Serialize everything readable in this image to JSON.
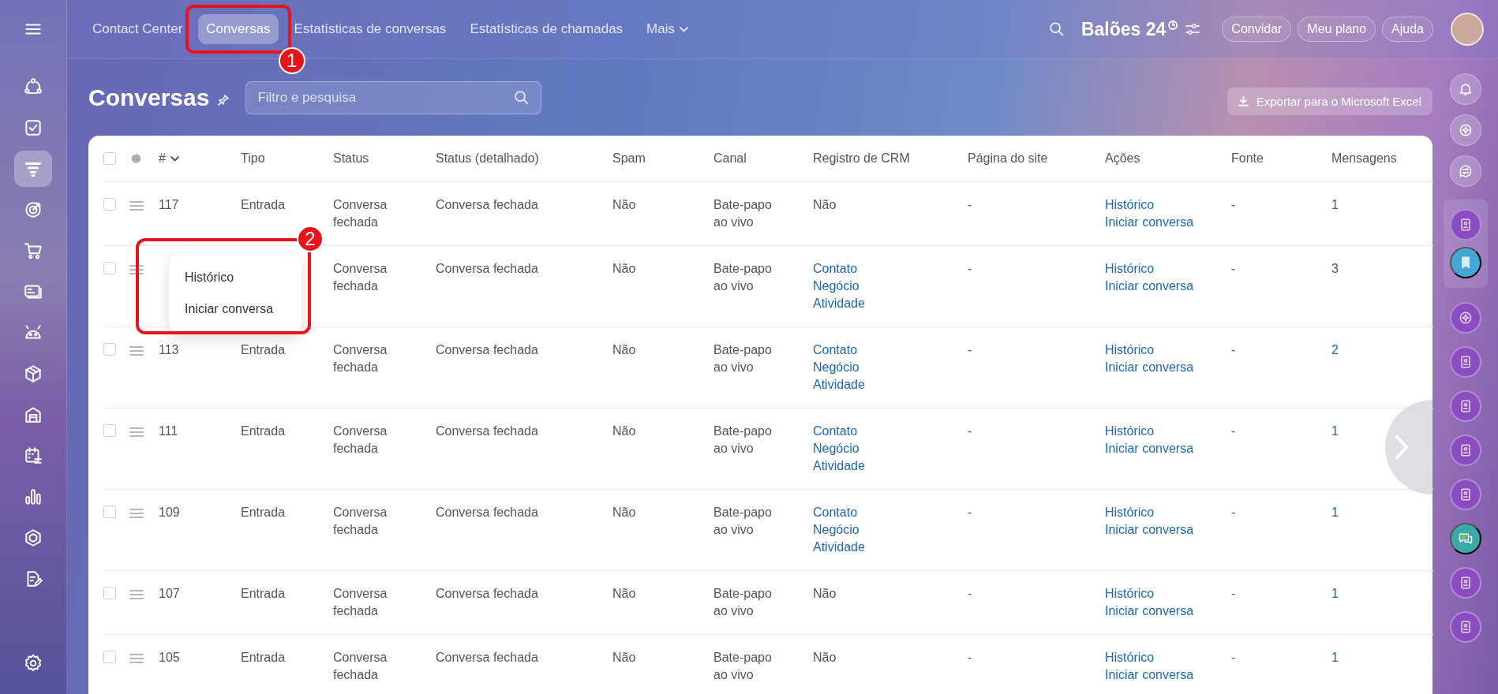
{
  "sidebar": {
    "items": [
      {
        "kind": "menu",
        "selected": false
      },
      {
        "kind": "nodes",
        "selected": false
      },
      {
        "kind": "task",
        "selected": false
      },
      {
        "kind": "funnel",
        "selected": true
      },
      {
        "kind": "target",
        "selected": false
      },
      {
        "kind": "cart",
        "selected": false
      },
      {
        "kind": "card",
        "selected": false
      },
      {
        "kind": "robot",
        "selected": false
      },
      {
        "kind": "cube",
        "selected": false
      },
      {
        "kind": "store",
        "selected": false
      },
      {
        "kind": "calendar",
        "selected": false
      },
      {
        "kind": "chart",
        "selected": false
      },
      {
        "kind": "hexagon",
        "selected": false
      },
      {
        "kind": "doc",
        "selected": false
      },
      {
        "kind": "gear",
        "selected": false
      }
    ]
  },
  "top_nav": {
    "tabs": [
      {
        "label": "Contact Center",
        "selected": false
      },
      {
        "label": "Conversas",
        "selected": true,
        "callout": "1"
      },
      {
        "label": "Estatísticas de conversas",
        "selected": false
      },
      {
        "label": "Estatísticas de chamadas",
        "selected": false
      },
      {
        "label": "Mais",
        "selected": false,
        "kind": "dropdown"
      }
    ],
    "workspace": "Balões 24",
    "buttons": [
      "Convidar",
      "Meu plano",
      "Ajuda"
    ]
  },
  "page": {
    "title": "Conversas",
    "search": {
      "placeholder": "Filtro e pesquisa"
    },
    "export_button": "Exportar para o Microsoft Excel"
  },
  "table": {
    "select_all_checked": false,
    "columns": [
      "#",
      "Tipo",
      "Status",
      "Status (detalhado)",
      "Spam",
      "Canal",
      "Registro de CRM",
      "Página do site",
      "Ações",
      "Fonte",
      "Mensagens"
    ],
    "rows": [
      {
        "checked": false,
        "id": "117",
        "type": "Entrada",
        "status": "Conversa fechada",
        "status_detail": "Conversa fechada",
        "spam": "Não",
        "channel": "Bate-papo ao vivo",
        "crm": {
          "kind": "text",
          "items": [
            "Não"
          ]
        },
        "page": "-",
        "actions": [
          "Histórico",
          "Iniciar conversa"
        ],
        "source": "-",
        "messages": "1",
        "messages_link": true
      },
      {
        "checked": false,
        "status": "Conversa fechada",
        "status_detail": "Conversa fechada",
        "spam": "Não",
        "channel": "Bate-papo ao vivo",
        "crm": {
          "kind": "links",
          "items": [
            "Contato",
            "Negócio",
            "Atividade"
          ]
        },
        "page": "-",
        "actions": [
          "Histórico",
          "Iniciar conversa"
        ],
        "source": "-",
        "messages": "3",
        "messages_link": false,
        "menu": {
          "items": [
            "Histórico",
            "Iniciar conversa"
          ],
          "callout": "2"
        }
      },
      {
        "checked": false,
        "id": "113",
        "type": "Entrada",
        "status": "Conversa fechada",
        "status_detail": "Conversa fechada",
        "spam": "Não",
        "channel": "Bate-papo ao vivo",
        "crm": {
          "kind": "links",
          "items": [
            "Contato",
            "Negócio",
            "Atividade"
          ]
        },
        "page": "-",
        "actions": [
          "Histórico",
          "Iniciar conversa"
        ],
        "source": "-",
        "messages": "2",
        "messages_link": true
      },
      {
        "checked": false,
        "id": "111",
        "type": "Entrada",
        "status": "Conversa fechada",
        "status_detail": "Conversa fechada",
        "spam": "Não",
        "channel": "Bate-papo ao vivo",
        "crm": {
          "kind": "links",
          "items": [
            "Contato",
            "Negócio",
            "Atividade"
          ]
        },
        "page": "-",
        "actions": [
          "Histórico",
          "Iniciar conversa"
        ],
        "source": "-",
        "messages": "1",
        "messages_link": true
      },
      {
        "checked": false,
        "id": "109",
        "type": "Entrada",
        "status": "Conversa fechada",
        "status_detail": "Conversa fechada",
        "spam": "Não",
        "channel": "Bate-papo ao vivo",
        "crm": {
          "kind": "links",
          "items": [
            "Contato",
            "Negócio",
            "Atividade"
          ]
        },
        "page": "-",
        "actions": [
          "Histórico",
          "Iniciar conversa"
        ],
        "source": "-",
        "messages": "1",
        "messages_link": true
      },
      {
        "checked": false,
        "id": "107",
        "type": "Entrada",
        "status": "Conversa fechada",
        "status_detail": "Conversa fechada",
        "spam": "Não",
        "channel": "Bate-papo ao vivo",
        "crm": {
          "kind": "text",
          "items": [
            "Não"
          ]
        },
        "page": "-",
        "actions": [
          "Histórico",
          "Iniciar conversa"
        ],
        "source": "-",
        "messages": "1",
        "messages_link": true
      },
      {
        "checked": false,
        "id": "105",
        "type": "Entrada",
        "status": "Conversa fechada",
        "status_detail": "Conversa fechada",
        "spam": "Não",
        "channel": "Bate-papo ao vivo",
        "crm": {
          "kind": "text",
          "items": [
            "Não"
          ]
        },
        "page": "-",
        "actions": [
          "Histórico",
          "Iniciar conversa"
        ],
        "source": "-",
        "messages": "1",
        "messages_link": true
      }
    ]
  },
  "right_rail": {
    "items": [
      {
        "kind": "bell"
      },
      {
        "kind": "copilot"
      },
      {
        "kind": "chat-swap"
      },
      {
        "kind": "contact",
        "pinned": true
      },
      {
        "kind": "bookmark",
        "pinned": true
      },
      {
        "kind": "copilot-purple"
      },
      {
        "kind": "contact"
      },
      {
        "kind": "contact"
      },
      {
        "kind": "contact"
      },
      {
        "kind": "contact"
      },
      {
        "kind": "chat"
      },
      {
        "kind": "contact"
      },
      {
        "kind": "contact"
      }
    ]
  }
}
